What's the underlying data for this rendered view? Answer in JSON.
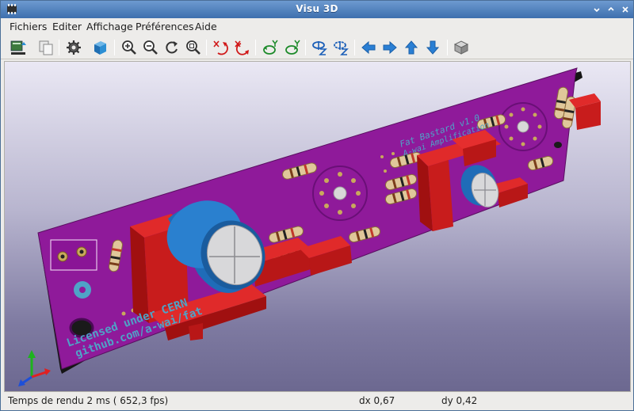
{
  "window": {
    "title": "Visu 3D",
    "title_bar_color": "#4a7ab8"
  },
  "menu": {
    "items": [
      "Fichiers",
      "Editer",
      "Affichage",
      "Préférences",
      "Aide"
    ]
  },
  "toolbar": {
    "icons": [
      "reload-board-icon",
      "copy-image-icon",
      "settings-gear-icon",
      "3d-box-icon",
      "zoom-in-icon",
      "zoom-out-icon",
      "redraw-icon",
      "zoom-fit-icon",
      "rotate-x-cw-icon",
      "rotate-x-ccw-icon",
      "rotate-y-cw-icon",
      "rotate-y-ccw-icon",
      "rotate-z-cw-icon",
      "rotate-z-ccw-icon",
      "move-left-icon",
      "move-right-icon",
      "move-up-icon",
      "move-down-icon",
      "ortho-view-icon"
    ]
  },
  "board": {
    "pcb_color": "#8f1a9a",
    "silk_text": {
      "title": "Fat Bastard v1.0",
      "subtitle": "A-wai Amplification",
      "license": "Licensed under CERN",
      "repo": "github.com/a-wai/fat"
    }
  },
  "status": {
    "render_time": "Temps de rendu 2 ms ( 652,3 fps)",
    "dx": "dx 0,67",
    "dy": "dy 0,42"
  }
}
